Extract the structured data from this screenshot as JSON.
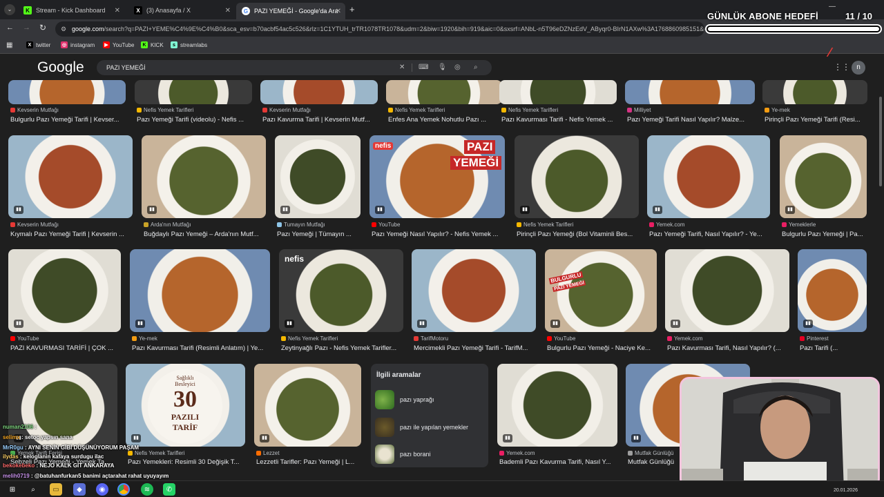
{
  "browser": {
    "tabs": [
      {
        "title": "Stream - Kick Dashboard",
        "icon": "kick-icon",
        "color": "#53fc18",
        "glyph": "K"
      },
      {
        "title": "(3) Anasayfa / X",
        "icon": "x-icon",
        "color": "#000000",
        "glyph": "X"
      },
      {
        "title": "PAZI YEMEĞİ - Google'da Ara",
        "icon": "google-icon",
        "color": "#ffffff",
        "glyph": "G"
      }
    ],
    "url_host": "google.com",
    "url_rest": "/search?q=PAZI+YEME%C4%9E%C4%B0&sca_esv=b70acbf54ac5c526&rlz=1C1YTUH_trTR1078TR1078&udm=2&biw=1920&bih=919&aic=0&sxsrf=ANbL-n5T96eDZNzEdV_AByqr0-BIrN1AXw%3A1768860985151&ei=Oa1uaduv",
    "bookmarks": [
      {
        "label": "twitter",
        "icon": "x-icon",
        "color": "#000000",
        "glyph": "X"
      },
      {
        "label": "instagram",
        "icon": "instagram-icon",
        "color": "#e1306c",
        "glyph": "◎"
      },
      {
        "label": "YouTube",
        "icon": "youtube-icon",
        "color": "#ff0000",
        "glyph": "▶"
      },
      {
        "label": "KICK",
        "icon": "kick-icon",
        "color": "#53fc18",
        "glyph": "K"
      },
      {
        "label": "streamlabs",
        "icon": "streamlabs-icon",
        "color": "#80f5d2",
        "glyph": "s"
      }
    ]
  },
  "overlay": {
    "goal_title": "GÜNLÜK ABONE HEDEFİ",
    "goal_count": "11  / 10",
    "goal_progress": 1.0
  },
  "google": {
    "logo": "Google",
    "query": "PAZI YEMEĞİ",
    "avatar": "n",
    "related_title": "İlgili aramalar",
    "related": [
      "pazı yaprağı",
      "pazı ile yapılan yemekler",
      "pazı borani"
    ]
  },
  "results": {
    "row1": [
      {
        "source": "Kevserin Mutfağı",
        "title": "Bulgurlu Pazı Yemeği Tarifi | Kevser...",
        "src_color": "#e53935"
      },
      {
        "source": "Nefis Yemek Tarifleri",
        "title": "Pazı Yemeği Tarifi (videolu) - Nefis ...",
        "src_color": "#f5b800"
      },
      {
        "source": "Kevserin Mutfağı",
        "title": "Pazı Kavurma Tarifi | Kevserin Mutf...",
        "src_color": "#e53935"
      },
      {
        "source": "Nefis Yemek Tarifleri",
        "title": "Enfes Ana Yemek Nohutlu Pazı ...",
        "src_color": "#f5b800"
      },
      {
        "source": "Nefis Yemek Tarifleri",
        "title": "Pazı Kavurması Tarifi - Nefis Yemek ...",
        "src_color": "#f5b800"
      },
      {
        "source": "Milliyet",
        "title": "Pazı Yemeği Tarifi Nasıl Yapılır? Malze...",
        "src_color": "#d63384"
      },
      {
        "source": "Ye-mek",
        "title": "Pirinçli Pazı Yemeği Tarifi (Resi...",
        "src_color": "#f39c12"
      }
    ],
    "row2": [
      {
        "source": "Kevserin Mutfağı",
        "title": "Kıymalı Pazı Yemeği Tarifi | Kevserin ...",
        "src_color": "#e53935"
      },
      {
        "source": "Arda'nın Mutfağı",
        "title": "Buğdaylı Pazı Yemeği – Arda'nın Mutf...",
        "src_color": "#c9a227"
      },
      {
        "source": "Tumayın Mutfağı",
        "title": "Pazı Yemeği | Tümayın ...",
        "src_color": "#8ec5e8"
      },
      {
        "source": "YouTube",
        "title": "Pazı Yemeği Nasıl Yapılır? - Nefis Yemek ...",
        "src_color": "#ff0000"
      },
      {
        "source": "Nefis Yemek Tarifleri",
        "title": "Pirinçli Pazı Yemeği (Bol Vitaminli Bes...",
        "src_color": "#f5b800"
      },
      {
        "source": "Yemek.com",
        "title": "Pazı Yemeği Tarifi, Nasıl Yapılır? - Ye...",
        "src_color": "#e91e63"
      },
      {
        "source": "Yemeklerle",
        "title": "Bulgurlu Pazı Yemeği | Pa...",
        "src_color": "#e91e63"
      }
    ],
    "row2_thumb_text": {
      "nefis": "nefis",
      "pazi": "PAZI",
      "yemegi": "YEMEĞİ"
    },
    "row3": [
      {
        "source": "YouTube",
        "title": "PAZI KAVURMASI TARİFİ | ÇOK ...",
        "src_color": "#ff0000"
      },
      {
        "source": "Ye-mek",
        "title": "Pazı Kavurması Tarifi (Resimli Anlatım) | Ye...",
        "src_color": "#f39c12"
      },
      {
        "source": "Nefis Yemek Tarifleri",
        "title": "Zeytinyağlı Pazı - Nefis Yemek Tarifler...",
        "src_color": "#f5b800"
      },
      {
        "source": "TarifMotoru",
        "title": "Mercimekli Pazı Yemeği Tarifi - TarifM...",
        "src_color": "#e53935"
      },
      {
        "source": "YouTube",
        "title": "Bulgurlu Pazı Yemeği - Naciye Ke...",
        "src_color": "#ff0000"
      },
      {
        "source": "Yemek.com",
        "title": "Pazı Kavurması Tarifi, Nasıl Yapılır? (...",
        "src_color": "#e91e63"
      },
      {
        "source": "Pinterest",
        "title": "Pazı Tarifi (...",
        "src_color": "#e60023"
      }
    ],
    "row3_thumb_text": {
      "bulgurlu": "BULGURLU",
      "pazi_yemegi": "PAZI YEMEĞİ"
    },
    "row4": [
      {
        "source": "Yemek Tarifi Ferisi",
        "title": "Sebzeli Pazı Yemeği - Yemek Ta...",
        "src_color": "#4caf50"
      },
      {
        "source": "Nefis Yemek Tarifleri",
        "title": "Pazı Yemekleri: Resimli 30 Değişik T...",
        "src_color": "#f5b800"
      },
      {
        "source": "Lezzet",
        "title": "Lezzetli Tarifler: Pazı Yemeği | L...",
        "src_color": "#ff6d00"
      },
      {
        "source": "Yemek.com",
        "title": "Bademli Pazı Kavurma Tarifi, Nasıl Y...",
        "src_color": "#e91e63"
      },
      {
        "source": "Mutfak Günlüğü",
        "title": "Mutfak Günlüğü",
        "src_color": "#9e9e9e"
      }
    ],
    "card30": {
      "line1": "Sağlıklı",
      "line2": "Besleyici",
      "num": "30",
      "line3": "PAZILI",
      "line4": "TARİF"
    }
  },
  "chat": [
    {
      "user": "numan2106",
      "msg": ":",
      "cls": "u1"
    },
    {
      "user": "selimx",
      "msg": ": setoç yapsın sana",
      "cls": "u2"
    },
    {
      "user": "MrR0gu",
      "msg": ": AYNI SENİN GİBİ DÜŞÜNÜYORUM PAŞAM",
      "cls": "u4"
    },
    {
      "user": "ilydas",
      "msg": ": keloglanin kafaya surdugu ilac",
      "cls": "u6"
    },
    {
      "user": "bekokebeko",
      "msg": ": NEJO KALK GİT ANKARAYA",
      "cls": "u3"
    },
    {
      "user": "melih0719",
      "msg": ": @batuhanfurkan5 banimi açtarahat rahat uyuyayım",
      "cls": "u5"
    }
  ],
  "taskbar": {
    "date": "20.01.2026",
    "icons": [
      "windows-icon",
      "search-icon",
      "file-explorer-icon",
      "app-icon",
      "discord-icon",
      "chrome-icon",
      "spotify-icon",
      "whatsapp-icon"
    ]
  }
}
